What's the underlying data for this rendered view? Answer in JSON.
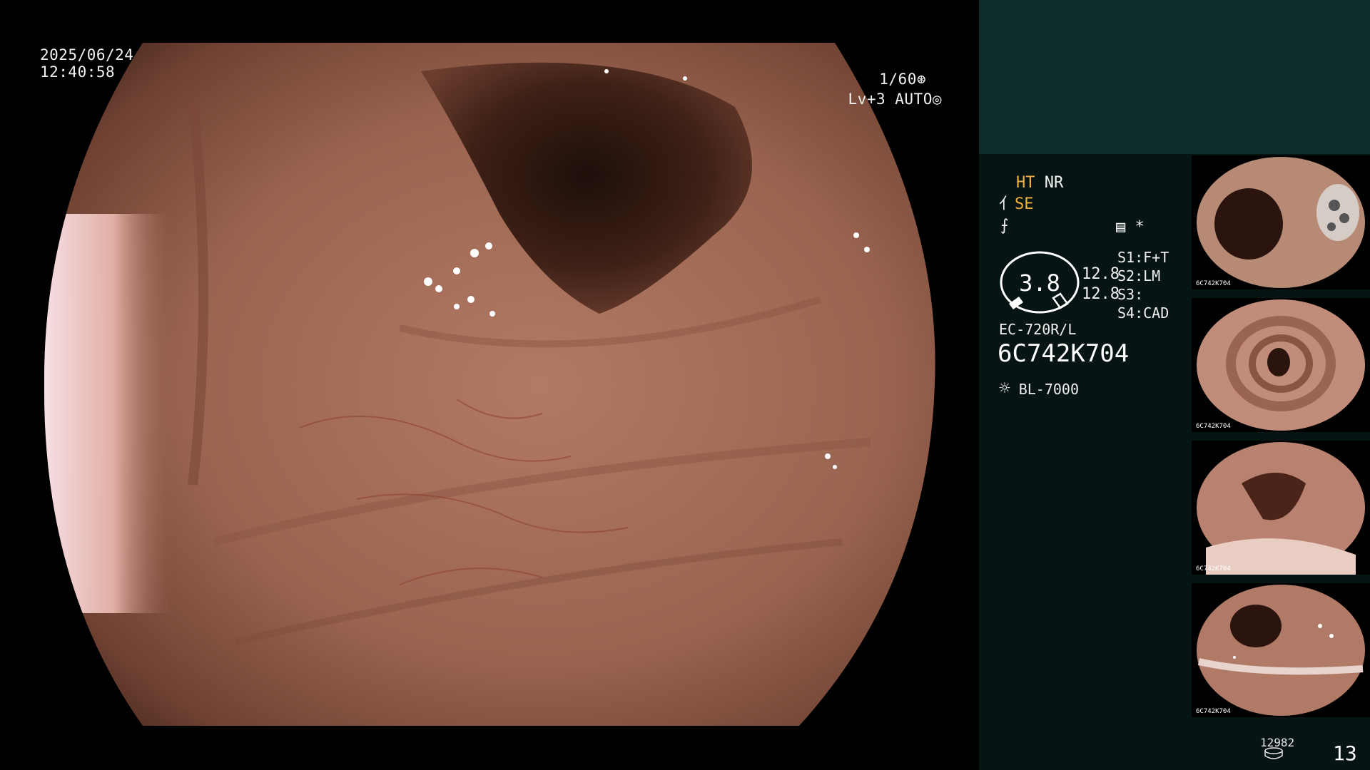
{
  "overlay": {
    "date": "2025/06/24",
    "time": "12:40:58",
    "shutter": "1/60",
    "level": "Lv+3",
    "iris_mode": "AUTO"
  },
  "panel": {
    "ht_label": "HT",
    "nr_label": "NR",
    "se_label": "SE",
    "star_label": "*",
    "dial_value": "3.8",
    "side_value_1": "12.8",
    "side_value_2": "12.8",
    "switches": [
      {
        "key": "S1",
        "value": "F+T"
      },
      {
        "key": "S2",
        "value": "LM"
      },
      {
        "key": "S3",
        "value": ""
      },
      {
        "key": "S4",
        "value": "CAD"
      }
    ],
    "scope_model": "EC-720R/L",
    "serial": "6C742K704",
    "light_source": "BL-7000"
  },
  "footer": {
    "image_count": "12982",
    "page": "13"
  },
  "thumbnails": [
    {
      "name": "thumb-1",
      "label": "6C742K704"
    },
    {
      "name": "thumb-2",
      "label": "6C742K704"
    },
    {
      "name": "thumb-3",
      "label": "6C742K704"
    },
    {
      "name": "thumb-4",
      "label": "6C742K704"
    }
  ],
  "colors": {
    "panel_bg": "#061413",
    "top_block": "#0d2b2a",
    "accent": "#f0b040",
    "tissue": "#a8705c"
  }
}
